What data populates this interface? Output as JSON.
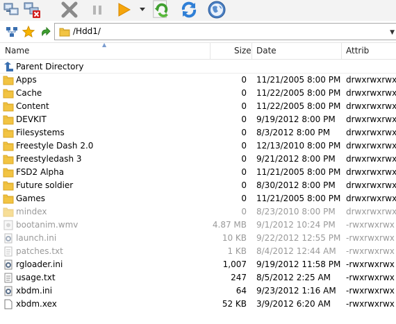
{
  "toolbar": {
    "items": [
      {
        "icon": "network-connect-icon"
      },
      {
        "icon": "network-disconnect-icon"
      },
      {
        "icon": "close-icon"
      },
      {
        "icon": "pause-icon"
      },
      {
        "icon": "play-icon"
      },
      {
        "icon": "dropdown-arrow-icon"
      },
      {
        "icon": "refresh-green-icon"
      },
      {
        "icon": "refresh-blue-icon"
      },
      {
        "icon": "globe-icon"
      }
    ]
  },
  "address_bar": {
    "path": "/Hdd1/"
  },
  "columns": {
    "name": "Name",
    "size": "Size",
    "date": "Date",
    "attrib": "Attrib"
  },
  "parent": {
    "label": "Parent Directory"
  },
  "files": [
    {
      "name": "Apps",
      "size": "0",
      "date": "11/21/2005 8:00 PM",
      "attrib": "drwxrwxrwx",
      "type": "folder",
      "hidden": false
    },
    {
      "name": "Cache",
      "size": "0",
      "date": "11/22/2005 8:00 PM",
      "attrib": "drwxrwxrwx",
      "type": "folder",
      "hidden": false
    },
    {
      "name": "Content",
      "size": "0",
      "date": "11/22/2005 8:00 PM",
      "attrib": "drwxrwxrwx",
      "type": "folder",
      "hidden": false
    },
    {
      "name": "DEVKIT",
      "size": "0",
      "date": "9/19/2012 8:00 PM",
      "attrib": "drwxrwxrwx",
      "type": "folder",
      "hidden": false
    },
    {
      "name": "Filesystems",
      "size": "0",
      "date": "8/3/2012 8:00 PM",
      "attrib": "drwxrwxrwx",
      "type": "folder",
      "hidden": false
    },
    {
      "name": "Freestyle Dash 2.0",
      "size": "0",
      "date": "12/13/2010 8:00 PM",
      "attrib": "drwxrwxrwx",
      "type": "folder",
      "hidden": false
    },
    {
      "name": "Freestyledash 3",
      "size": "0",
      "date": "9/21/2012 8:00 PM",
      "attrib": "drwxrwxrwx",
      "type": "folder",
      "hidden": false
    },
    {
      "name": "FSD2 Alpha",
      "size": "0",
      "date": "11/21/2005 8:00 PM",
      "attrib": "drwxrwxrwx",
      "type": "folder",
      "hidden": false
    },
    {
      "name": "Future soldier",
      "size": "0",
      "date": "8/30/2012 8:00 PM",
      "attrib": "drwxrwxrwx",
      "type": "folder",
      "hidden": false
    },
    {
      "name": "Games",
      "size": "0",
      "date": "11/21/2005 8:00 PM",
      "attrib": "drwxrwxrwx",
      "type": "folder",
      "hidden": false
    },
    {
      "name": "mindex",
      "size": "0",
      "date": "8/23/2010 8:00 PM",
      "attrib": "drwxrwxrwx",
      "type": "folder",
      "hidden": true
    },
    {
      "name": "bootanim.wmv",
      "size": "4.87 MB",
      "date": "9/1/2012 10:24 PM",
      "attrib": "-rwxrwxrwx",
      "type": "media",
      "hidden": true
    },
    {
      "name": "launch.ini",
      "size": "10 KB",
      "date": "9/22/2012 12:55 PM",
      "attrib": "-rwxrwxrwx",
      "type": "config",
      "hidden": true
    },
    {
      "name": "patches.txt",
      "size": "1 KB",
      "date": "8/4/2012 12:44 AM",
      "attrib": "-rwxrwxrwx",
      "type": "text",
      "hidden": true
    },
    {
      "name": "rgloader.ini",
      "size": "1,007",
      "date": "9/19/2012 11:58 PM",
      "attrib": "-rwxrwxrwx",
      "type": "config",
      "hidden": false
    },
    {
      "name": "usage.txt",
      "size": "247",
      "date": "8/5/2012 2:25 AM",
      "attrib": "-rwxrwxrwx",
      "type": "text",
      "hidden": false
    },
    {
      "name": "xbdm.ini",
      "size": "64",
      "date": "9/23/2012 1:16 AM",
      "attrib": "-rwxrwxrwx",
      "type": "config",
      "hidden": false
    },
    {
      "name": "xbdm.xex",
      "size": "52 KB",
      "date": "3/9/2012 6:20 AM",
      "attrib": "-rwxrwxrwx",
      "type": "file",
      "hidden": false
    }
  ],
  "colors": {
    "folder": "#f2c443",
    "folder_dark": "#d9a521",
    "hidden_text": "#9a9a9a",
    "header_border": "#e5e5e5"
  }
}
